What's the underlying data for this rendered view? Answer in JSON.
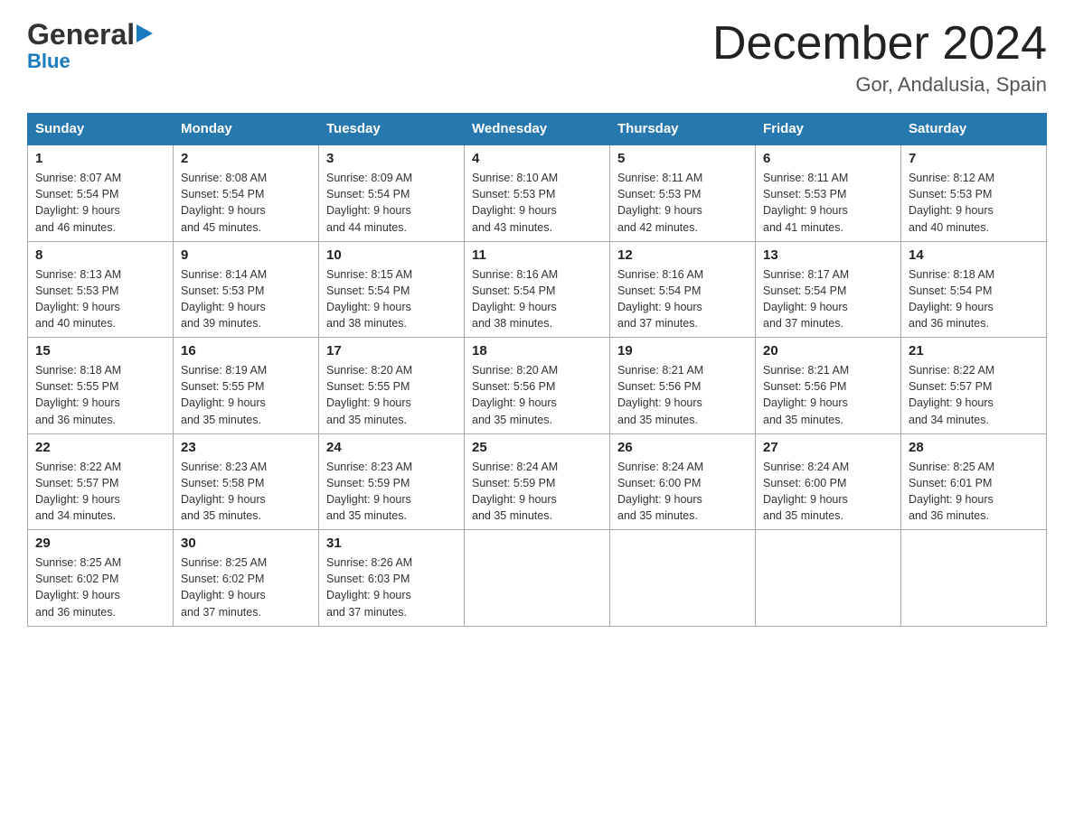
{
  "header": {
    "logo_general": "General",
    "logo_blue": "Blue",
    "month": "December 2024",
    "location": "Gor, Andalusia, Spain"
  },
  "days_of_week": [
    "Sunday",
    "Monday",
    "Tuesday",
    "Wednesday",
    "Thursday",
    "Friday",
    "Saturday"
  ],
  "weeks": [
    [
      {
        "day": "1",
        "sunrise": "8:07 AM",
        "sunset": "5:54 PM",
        "daylight": "9 hours and 46 minutes."
      },
      {
        "day": "2",
        "sunrise": "8:08 AM",
        "sunset": "5:54 PM",
        "daylight": "9 hours and 45 minutes."
      },
      {
        "day": "3",
        "sunrise": "8:09 AM",
        "sunset": "5:54 PM",
        "daylight": "9 hours and 44 minutes."
      },
      {
        "day": "4",
        "sunrise": "8:10 AM",
        "sunset": "5:53 PM",
        "daylight": "9 hours and 43 minutes."
      },
      {
        "day": "5",
        "sunrise": "8:11 AM",
        "sunset": "5:53 PM",
        "daylight": "9 hours and 42 minutes."
      },
      {
        "day": "6",
        "sunrise": "8:11 AM",
        "sunset": "5:53 PM",
        "daylight": "9 hours and 41 minutes."
      },
      {
        "day": "7",
        "sunrise": "8:12 AM",
        "sunset": "5:53 PM",
        "daylight": "9 hours and 40 minutes."
      }
    ],
    [
      {
        "day": "8",
        "sunrise": "8:13 AM",
        "sunset": "5:53 PM",
        "daylight": "9 hours and 40 minutes."
      },
      {
        "day": "9",
        "sunrise": "8:14 AM",
        "sunset": "5:53 PM",
        "daylight": "9 hours and 39 minutes."
      },
      {
        "day": "10",
        "sunrise": "8:15 AM",
        "sunset": "5:54 PM",
        "daylight": "9 hours and 38 minutes."
      },
      {
        "day": "11",
        "sunrise": "8:16 AM",
        "sunset": "5:54 PM",
        "daylight": "9 hours and 38 minutes."
      },
      {
        "day": "12",
        "sunrise": "8:16 AM",
        "sunset": "5:54 PM",
        "daylight": "9 hours and 37 minutes."
      },
      {
        "day": "13",
        "sunrise": "8:17 AM",
        "sunset": "5:54 PM",
        "daylight": "9 hours and 37 minutes."
      },
      {
        "day": "14",
        "sunrise": "8:18 AM",
        "sunset": "5:54 PM",
        "daylight": "9 hours and 36 minutes."
      }
    ],
    [
      {
        "day": "15",
        "sunrise": "8:18 AM",
        "sunset": "5:55 PM",
        "daylight": "9 hours and 36 minutes."
      },
      {
        "day": "16",
        "sunrise": "8:19 AM",
        "sunset": "5:55 PM",
        "daylight": "9 hours and 35 minutes."
      },
      {
        "day": "17",
        "sunrise": "8:20 AM",
        "sunset": "5:55 PM",
        "daylight": "9 hours and 35 minutes."
      },
      {
        "day": "18",
        "sunrise": "8:20 AM",
        "sunset": "5:56 PM",
        "daylight": "9 hours and 35 minutes."
      },
      {
        "day": "19",
        "sunrise": "8:21 AM",
        "sunset": "5:56 PM",
        "daylight": "9 hours and 35 minutes."
      },
      {
        "day": "20",
        "sunrise": "8:21 AM",
        "sunset": "5:56 PM",
        "daylight": "9 hours and 35 minutes."
      },
      {
        "day": "21",
        "sunrise": "8:22 AM",
        "sunset": "5:57 PM",
        "daylight": "9 hours and 34 minutes."
      }
    ],
    [
      {
        "day": "22",
        "sunrise": "8:22 AM",
        "sunset": "5:57 PM",
        "daylight": "9 hours and 34 minutes."
      },
      {
        "day": "23",
        "sunrise": "8:23 AM",
        "sunset": "5:58 PM",
        "daylight": "9 hours and 35 minutes."
      },
      {
        "day": "24",
        "sunrise": "8:23 AM",
        "sunset": "5:59 PM",
        "daylight": "9 hours and 35 minutes."
      },
      {
        "day": "25",
        "sunrise": "8:24 AM",
        "sunset": "5:59 PM",
        "daylight": "9 hours and 35 minutes."
      },
      {
        "day": "26",
        "sunrise": "8:24 AM",
        "sunset": "6:00 PM",
        "daylight": "9 hours and 35 minutes."
      },
      {
        "day": "27",
        "sunrise": "8:24 AM",
        "sunset": "6:00 PM",
        "daylight": "9 hours and 35 minutes."
      },
      {
        "day": "28",
        "sunrise": "8:25 AM",
        "sunset": "6:01 PM",
        "daylight": "9 hours and 36 minutes."
      }
    ],
    [
      {
        "day": "29",
        "sunrise": "8:25 AM",
        "sunset": "6:02 PM",
        "daylight": "9 hours and 36 minutes."
      },
      {
        "day": "30",
        "sunrise": "8:25 AM",
        "sunset": "6:02 PM",
        "daylight": "9 hours and 37 minutes."
      },
      {
        "day": "31",
        "sunrise": "8:26 AM",
        "sunset": "6:03 PM",
        "daylight": "9 hours and 37 minutes."
      },
      null,
      null,
      null,
      null
    ]
  ],
  "labels": {
    "sunrise": "Sunrise:",
    "sunset": "Sunset:",
    "daylight": "Daylight:"
  }
}
